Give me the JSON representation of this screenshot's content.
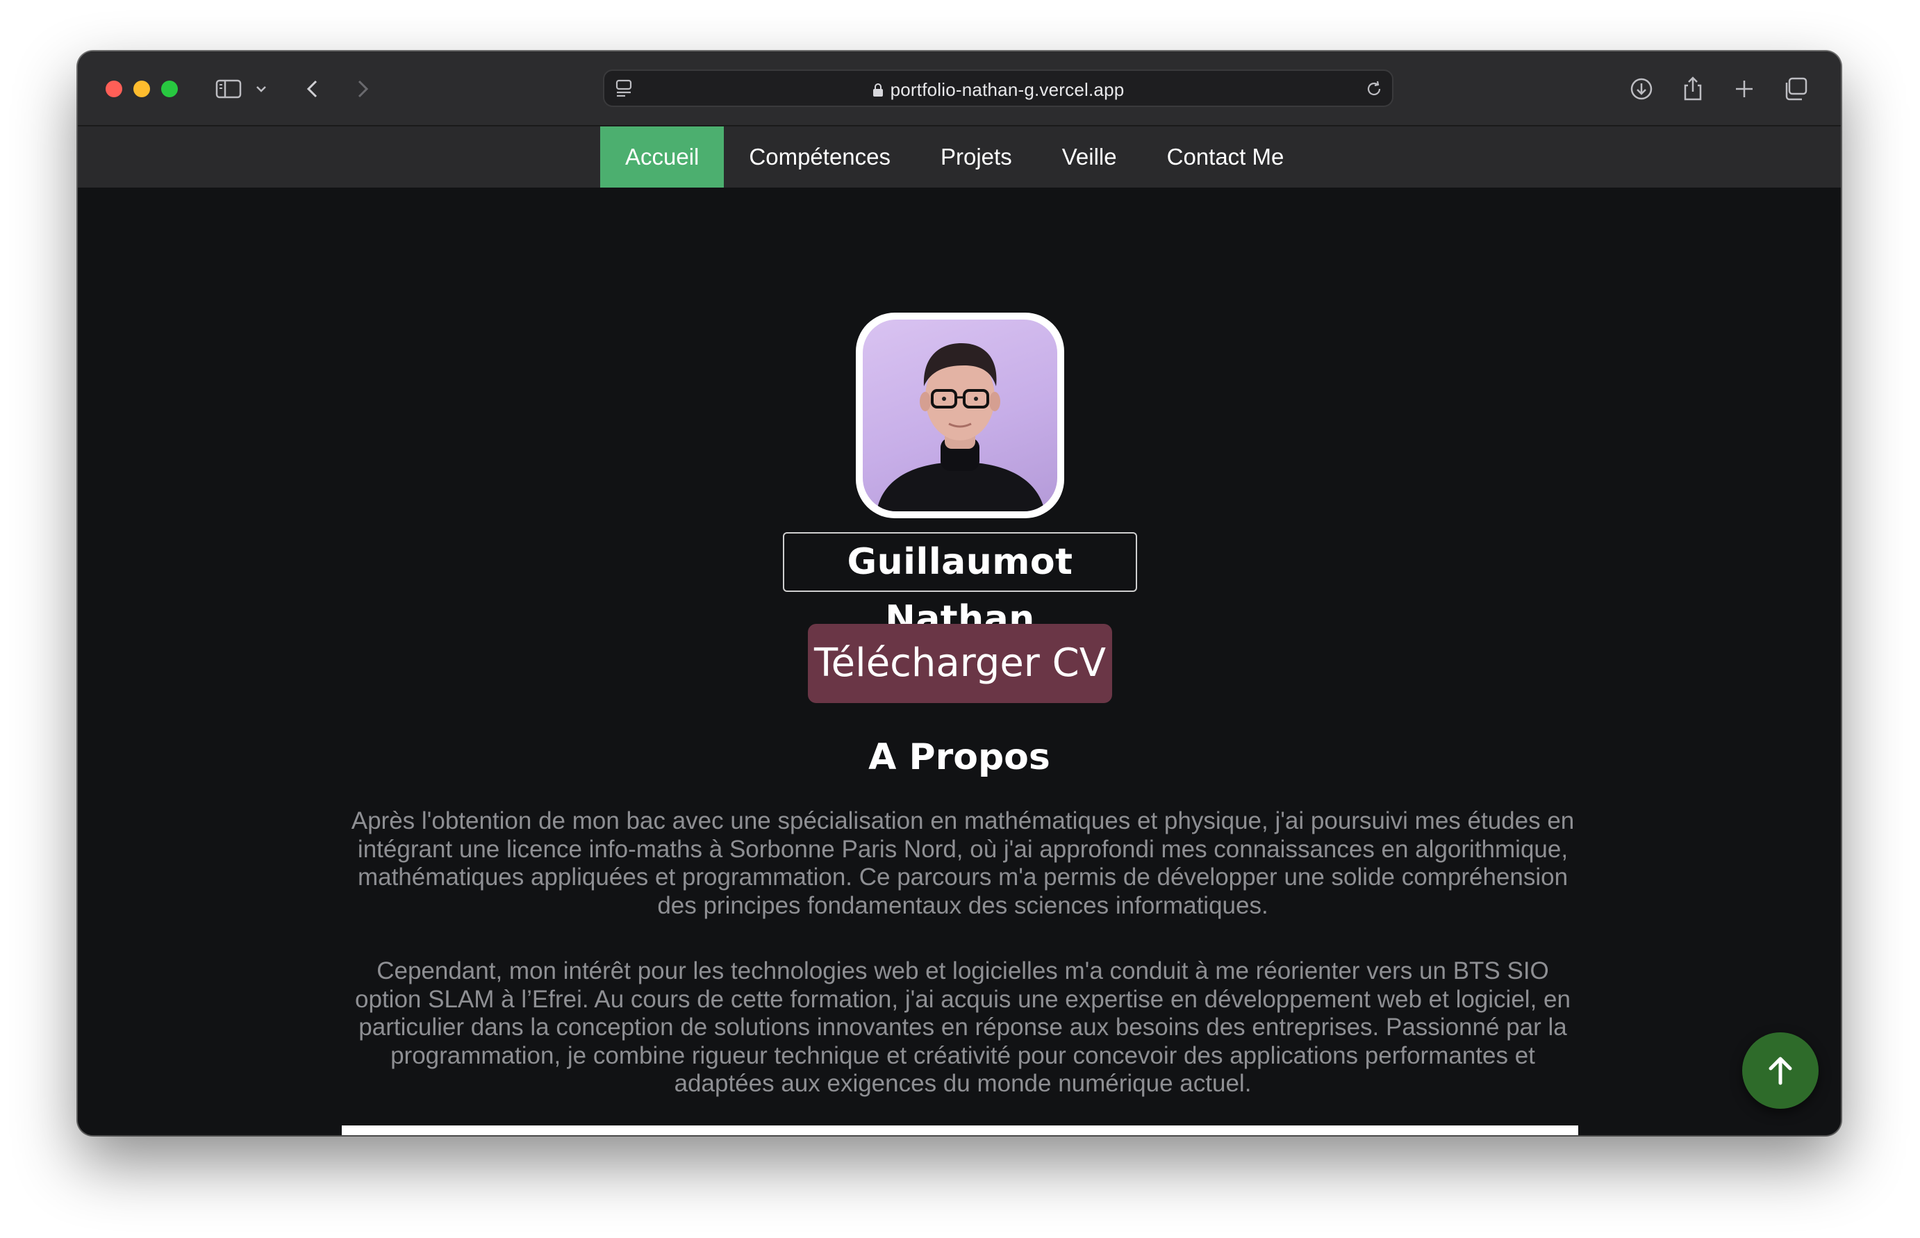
{
  "browser": {
    "url": "portfolio-nathan-g.vercel.app"
  },
  "nav": {
    "items": [
      {
        "label": "Accueil",
        "active": true
      },
      {
        "label": "Compétences",
        "active": false
      },
      {
        "label": "Projets",
        "active": false
      },
      {
        "label": "Veille",
        "active": false
      },
      {
        "label": "Contact Me",
        "active": false
      }
    ]
  },
  "profile": {
    "name": "Guillaumot Nathan",
    "cv_button": "Télécharger CV"
  },
  "about": {
    "title": "A Propos",
    "paragraphs": [
      "Après l'obtention de mon bac avec une spécialisation en mathématiques et physique, j'ai poursuivi mes études en intégrant une licence info-maths à Sorbonne Paris Nord, où j'ai approfondi mes connaissances en algorithmique, mathématiques appliquées et programmation. Ce parcours m'a permis de développer une solide compréhension des principes fondamentaux des sciences informatiques.",
      "Cependant, mon intérêt pour les technologies web et logicielles m'a conduit à me réorienter vers un BTS SIO option SLAM à l’Efrei. Au cours de cette formation, j'ai acquis une expertise en développement web et logiciel, en particulier dans la conception de solutions innovantes en réponse aux besoins des entreprises. Passionné par la programmation, je combine rigueur technique et créativité pour concevoir des applications performantes et adaptées aux exigences du monde numérique actuel."
    ]
  },
  "colors": {
    "nav_active": "#4caf6f",
    "cv_button": "#6a3646",
    "scroll_button": "#2e6b2a",
    "background": "#111214"
  },
  "icons": {
    "scroll_top": "arrow-up-icon",
    "sidebar": "sidebar-icon",
    "back": "chevron-left-icon",
    "forward": "chevron-right-icon",
    "download": "download-icon",
    "share": "share-icon",
    "new_tab": "plus-icon",
    "tabs": "tabs-overview-icon"
  }
}
